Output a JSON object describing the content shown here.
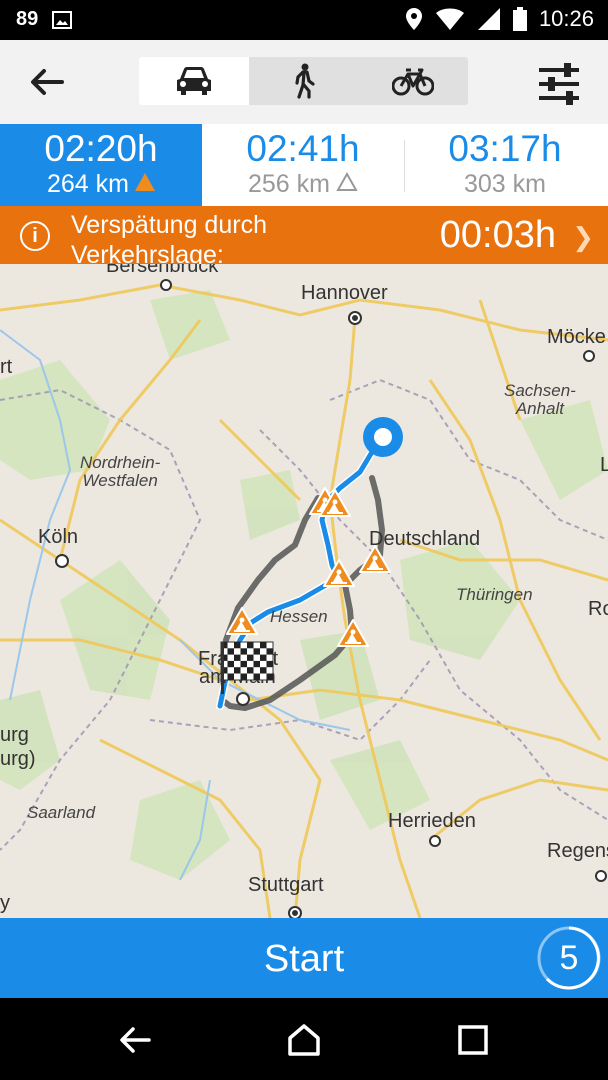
{
  "status_bar": {
    "notification_count": "89",
    "time": "10:26",
    "icons": [
      "image-icon",
      "location-icon",
      "wifi-icon",
      "signal-icon",
      "battery-icon"
    ]
  },
  "toolbar": {
    "back_icon": "arrow-left-icon",
    "modes": [
      {
        "name": "car",
        "icon": "car-icon",
        "active": true
      },
      {
        "name": "walk",
        "icon": "pedestrian-icon",
        "active": false
      },
      {
        "name": "bike",
        "icon": "bicycle-icon",
        "active": false
      }
    ],
    "settings_icon": "sliders-icon"
  },
  "routes": [
    {
      "time": "02:20h",
      "distance": "264 km",
      "warning": "filled",
      "active": true
    },
    {
      "time": "02:41h",
      "distance": "256 km",
      "warning": "outline",
      "active": false
    },
    {
      "time": "03:17h",
      "distance": "303 km",
      "warning": "none",
      "active": false
    }
  ],
  "delay": {
    "label": "Verspätung durch Verkehrslage:",
    "value": "00:03h"
  },
  "map": {
    "cities": [
      {
        "id": "bersenbrueck",
        "name": "Bersenbrück"
      },
      {
        "id": "hannover",
        "name": "Hannover"
      },
      {
        "id": "moecke",
        "name": "Möcke"
      },
      {
        "id": "rt",
        "name": "rt"
      },
      {
        "id": "koeln",
        "name": "Köln"
      },
      {
        "id": "deutschland",
        "name": "Deutschland"
      },
      {
        "id": "frankfurt1",
        "name": "Frankfurt"
      },
      {
        "id": "frankfurt2",
        "name": "am Main"
      },
      {
        "id": "herrieden",
        "name": "Herrieden"
      },
      {
        "id": "regens",
        "name": "Regens"
      },
      {
        "id": "stuttgart",
        "name": "Stuttgart"
      },
      {
        "id": "urg1",
        "name": "urg"
      },
      {
        "id": "urg2",
        "name": "urg)"
      },
      {
        "id": "ro",
        "name": "Ro"
      },
      {
        "id": "l",
        "name": "L"
      },
      {
        "id": "y",
        "name": "y"
      }
    ],
    "regions": [
      {
        "id": "sachsen",
        "name": "Sachsen-\nAnhalt"
      },
      {
        "id": "nrw",
        "name": "Nordrhein-\nWestfalen"
      },
      {
        "id": "hessen",
        "name": "Hessen"
      },
      {
        "id": "thueringen",
        "name": "Thüringen"
      },
      {
        "id": "saarland",
        "name": "Saarland"
      }
    ],
    "route_color_primary": "#1a8ce8",
    "route_color_alt": "#555555",
    "roadwork_color": "#f08c1e"
  },
  "start": {
    "label": "Start",
    "countdown": "5"
  },
  "nav_bar": {
    "icons": [
      "back-triangle-icon",
      "home-icon",
      "recents-icon"
    ]
  },
  "colors": {
    "accent": "#1a8ce8",
    "warning": "#e8720e"
  }
}
